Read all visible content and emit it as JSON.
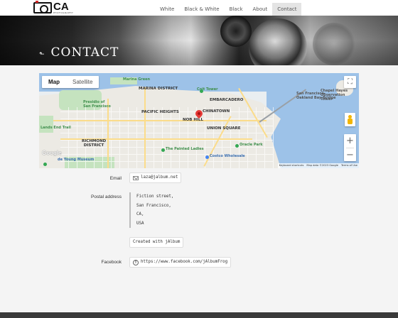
{
  "site": {
    "logo_text": "CA",
    "logo_sub": "PHOTOGRAPHY"
  },
  "nav": {
    "items": [
      {
        "label": "White",
        "active": false
      },
      {
        "label": "Black & White",
        "active": false
      },
      {
        "label": "Black",
        "active": false
      },
      {
        "label": "About",
        "active": false
      },
      {
        "label": "Contact",
        "active": true
      }
    ]
  },
  "hero": {
    "back_icon": "back-arrow-icon",
    "title": "Contact"
  },
  "map": {
    "tabs": [
      {
        "label": "Map",
        "active": true
      },
      {
        "label": "Satellite",
        "active": false
      }
    ],
    "labels": {
      "marina_green": "Marina Green",
      "marina_district": "MARINA DISTRICT",
      "coit_tower": "Coit Tower",
      "embarcadero": "EMBARCADERO",
      "treasure": "Treasure Island",
      "sf_oakland": "San Francisco-Oakland Bay Bridge",
      "chapel": "Chapel Hayes Observation Tower",
      "presidio": "Presidio of San Francisco",
      "pacific_heights": "PACIFIC HEIGHTS",
      "chinatown": "CHINATOWN",
      "nob_hill": "NOB HILL",
      "union_square": "UNION SQUARE",
      "lands_end": "Lands End Trail",
      "richmond": "RICHMOND DISTRICT",
      "painted_ladies": "The Painted Ladies",
      "oracle_park": "Oracle Park",
      "costco": "Costco Wholesale",
      "young_museum": "de Young Museum",
      "outer": "OUTER DISTRICT",
      "presidio_heights": "PRESIDIO HEIGHTS"
    },
    "google": "Google",
    "attribution": {
      "shortcuts": "Keyboard shortcuts",
      "data": "Map data ©2023 Google",
      "terms": "Terms of Use"
    },
    "zoom_in": "+",
    "zoom_out": "−",
    "fullscreen_icon": "fullscreen-icon"
  },
  "contact": {
    "email_label": "Email",
    "email": "laza@jalbum.net",
    "postal_label": "Postal address",
    "address_lines": [
      "Fiction street,",
      "San Francisco,",
      "CA,",
      "USA"
    ],
    "credit": "Created with jAlbum",
    "facebook_label": "Facebook",
    "facebook_url": "https://www.facebook.com/jAlbumFrog"
  }
}
